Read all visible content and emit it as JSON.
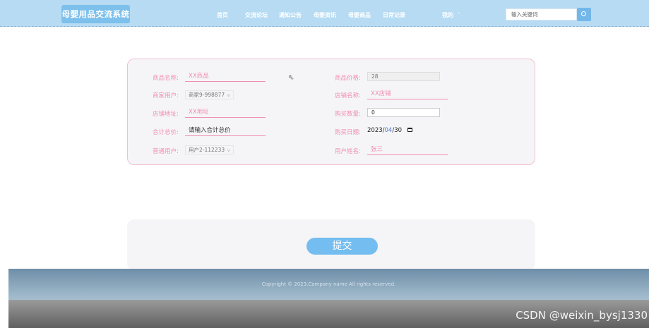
{
  "header": {
    "logo": "母婴用品交流系统",
    "nav": [
      "首页",
      "交流论坛",
      "通知公告",
      "母婴资讯",
      "母婴商品",
      "日常记录",
      "我的"
    ],
    "search_placeholder": "输入关键词"
  },
  "form": {
    "product_name_label": "商品名称:",
    "product_name_value": "XX商品",
    "product_price_label": "商品价格:",
    "product_price_value": "28",
    "merchant_user_label": "商家用户:",
    "merchant_user_value": "商家9-998877",
    "store_name_label": "店铺名称:",
    "store_name_value": "XX店铺",
    "store_address_label": "店铺地址:",
    "store_address_value": "XX地址",
    "quantity_label": "购买数量:",
    "quantity_value": "0",
    "total_label": "合计总价:",
    "total_placeholder": "请输入合计总价",
    "purchase_date_label": "购买日期:",
    "date_year": "2023",
    "date_month": "04",
    "date_day": "30",
    "normal_user_label": "普通用户:",
    "normal_user_value": "用户2-112233",
    "user_name_label": "用户姓名:",
    "user_name_value": "张三"
  },
  "submit_label": "提交",
  "footer": {
    "copyright": "Copyright © 2023.Company name All rights reserved."
  },
  "watermark": "CSDN @weixin_bysj1330"
}
